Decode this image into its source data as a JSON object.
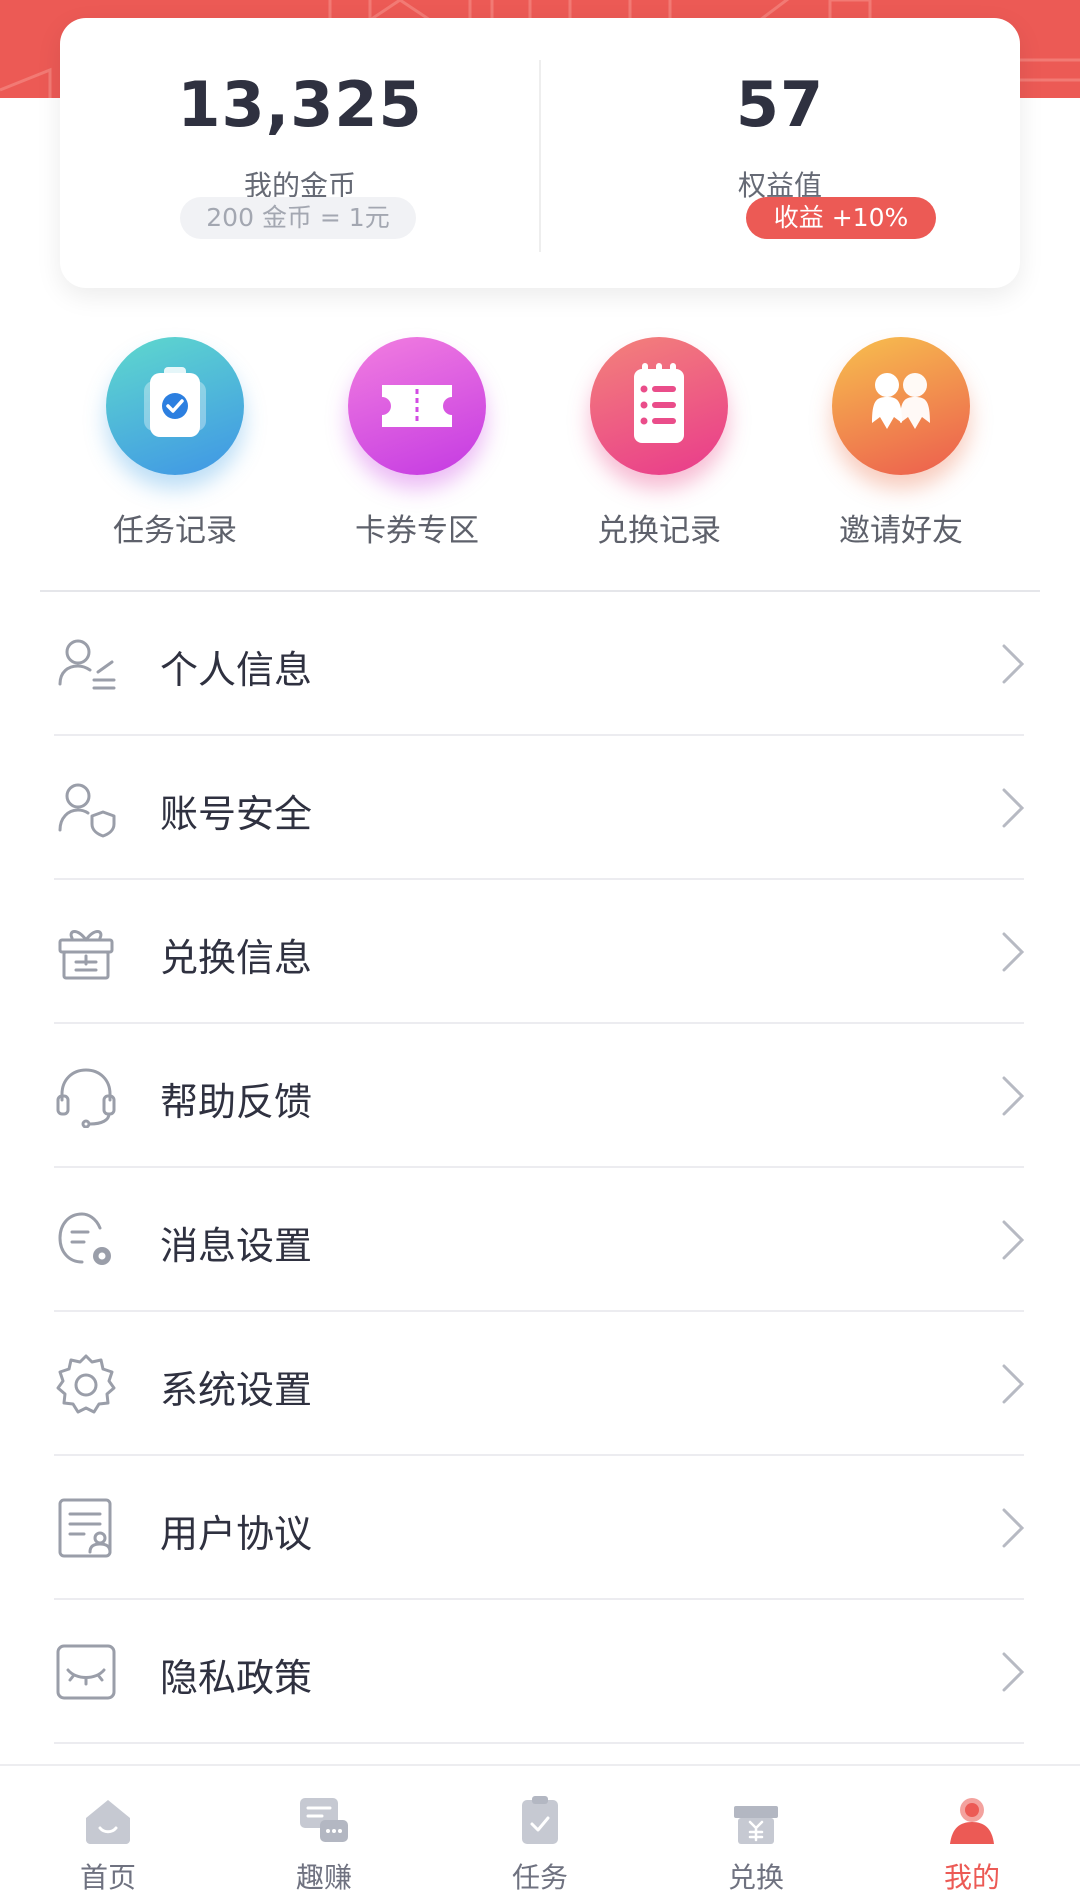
{
  "stats": {
    "coins_value": "13,325",
    "coins_label": "我的金币",
    "coins_rate": "200 金币 = 1元",
    "equity_value": "57",
    "equity_label": "权益值",
    "equity_bonus": "收益 +10%"
  },
  "shortcuts": [
    {
      "label": "任务记录",
      "icon": "clipboard-check-icon",
      "color": "#46b6d8"
    },
    {
      "label": "卡券专区",
      "icon": "ticket-icon",
      "color": "#d93fe0"
    },
    {
      "label": "兑换记录",
      "icon": "list-icon",
      "color": "#ee4f8a"
    },
    {
      "label": "邀请好友",
      "icon": "friends-icon",
      "color": "#f08a3c"
    }
  ],
  "menu": [
    {
      "label": "个人信息",
      "icon": "user-edit-icon"
    },
    {
      "label": "账号安全",
      "icon": "user-shield-icon"
    },
    {
      "label": "兑换信息",
      "icon": "gift-icon"
    },
    {
      "label": "帮助反馈",
      "icon": "headset-icon"
    },
    {
      "label": "消息设置",
      "icon": "message-settings-icon"
    },
    {
      "label": "系统设置",
      "icon": "gear-icon"
    },
    {
      "label": "用户协议",
      "icon": "document-user-icon"
    },
    {
      "label": "隐私政策",
      "icon": "eye-closed-icon"
    }
  ],
  "tabs": [
    {
      "label": "首页",
      "icon": "home-icon"
    },
    {
      "label": "趣赚",
      "icon": "chat-icon"
    },
    {
      "label": "任务",
      "icon": "clipboard-icon"
    },
    {
      "label": "兑换",
      "icon": "gift-yuan-icon"
    },
    {
      "label": "我的",
      "icon": "user-icon",
      "active": true
    }
  ],
  "colors": {
    "accent": "#ec5a55",
    "text_dark": "#2f3140",
    "icon_gray": "#9a9ea9"
  }
}
